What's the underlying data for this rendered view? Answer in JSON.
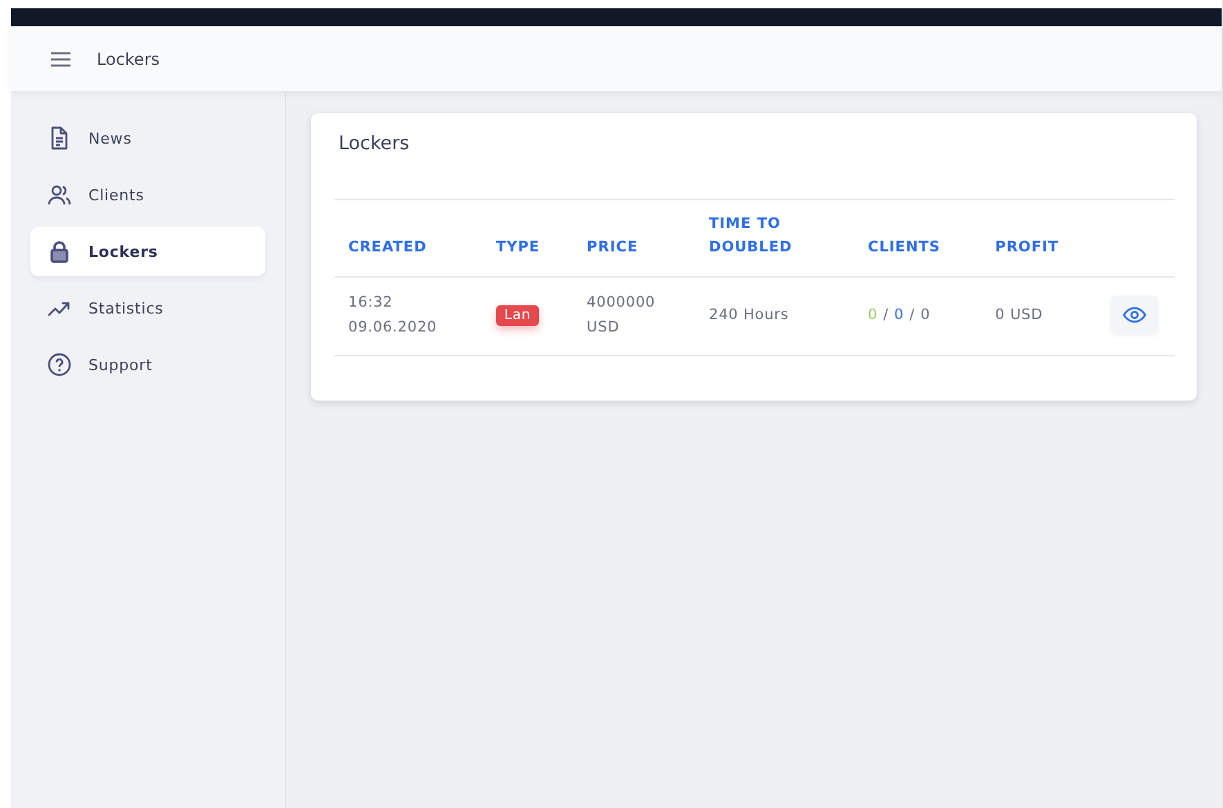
{
  "header": {
    "title": "Lockers"
  },
  "sidebar": {
    "items": [
      {
        "label": "News",
        "kind": "document",
        "selected": false
      },
      {
        "label": "Clients",
        "kind": "users",
        "selected": false
      },
      {
        "label": "Lockers",
        "kind": "lock",
        "selected": true
      },
      {
        "label": "Statistics",
        "kind": "trend",
        "selected": false
      },
      {
        "label": "Support",
        "kind": "help",
        "selected": false
      }
    ]
  },
  "card": {
    "title": "Lockers",
    "table": {
      "columns": [
        "CREATED",
        "TYPE",
        "PRICE",
        "TIME TO DOUBLED",
        "CLIENTS",
        "PROFIT"
      ],
      "rows": [
        {
          "created": [
            "16:32",
            "09.06.2020"
          ],
          "type": {
            "label": "Lan",
            "color": "#e5484d"
          },
          "price": [
            "4000000",
            "USD"
          ],
          "time": "240 Hours",
          "clients": {
            "separator": "/",
            "parts": [
              {
                "text": "0",
                "color": "#9ccc65"
              },
              {
                "text": "0",
                "color": "#3b6ee8"
              },
              {
                "text": "0",
                "color": "#6b6f80"
              }
            ]
          },
          "profit": "0 USD"
        }
      ]
    }
  }
}
